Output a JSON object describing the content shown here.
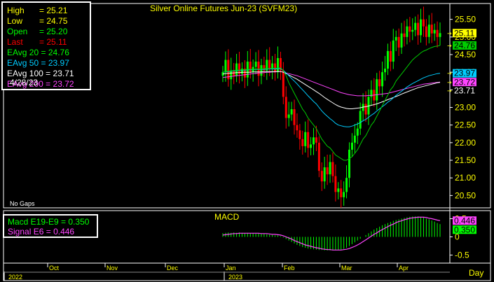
{
  "title": "Silver Online Futures Jun-23 (SVFM23)",
  "info": {
    "high_label": "High",
    "high": "25.21",
    "low_label": "Low",
    "low": "24.75",
    "open_label": "Open",
    "open": "25.20",
    "last_label": "Last",
    "last": "25.11",
    "eavg20_label": "EAvg 20",
    "eavg20": "24.76",
    "eavg50_label": "EAvg 50",
    "eavg50": "23.97",
    "eavg100_label": "EAvg 100",
    "eavg100": "23.71",
    "eavg200_label": "EAvg 200",
    "eavg200": "23.72",
    "date": "4/28/23"
  },
  "no_gaps": "No Gaps",
  "macd": {
    "title": "MACD",
    "macd_label": "Macd E19-E9 =",
    "macd_value": "0.350",
    "signal_label": "Signal E6 =",
    "signal_value": "0.446",
    "tag_signal": "0.446",
    "tag_macd": "0.350"
  },
  "price_tags": {
    "last": "25.11",
    "eavg20": "24.76",
    "eavg50": "23.97",
    "eavg200": "23.72",
    "eavg100": "23.71"
  },
  "x_axis": {
    "months": [
      "Oct",
      "Nov",
      "Dec",
      "Jan",
      "Feb",
      "Mar",
      "Apr"
    ],
    "years": [
      "2022",
      "2023"
    ],
    "period_label": "Day"
  },
  "colors": {
    "up": "#00ff00",
    "down": "#ff0000",
    "neutral": "#ffff00",
    "eavg20": "#00cc00",
    "eavg50": "#00ccff",
    "eavg100": "#ffffff",
    "eavg200": "#ff44ff",
    "macd_hist": "#00ff00",
    "signal": "#ff44ff",
    "axis_text": "#ffff00"
  },
  "chart_data": [
    {
      "type": "candlestick",
      "title": "Silver Online Futures Jun-23 (SVFM23)",
      "y_ticks": [
        20.5,
        21.0,
        21.5,
        22.0,
        22.5,
        23.0,
        23.5,
        24.0,
        24.5,
        25.0,
        25.5
      ],
      "ylim": [
        20.15,
        25.95
      ],
      "bar_count": 80,
      "month_start_index": {
        "Jan": 0,
        "Feb": 22,
        "Mar": 42,
        "Apr": 64
      },
      "closes": [
        24.0,
        24.35,
        23.8,
        24.05,
        23.9,
        24.25,
        23.95,
        24.1,
        23.85,
        24.3,
        24.0,
        24.15,
        24.3,
        23.9,
        24.2,
        24.05,
        24.35,
        24.1,
        24.25,
        24.0,
        24.4,
        24.05,
        23.3,
        22.7,
        22.8,
        22.95,
        22.5,
        22.35,
        22.1,
        21.9,
        22.3,
        21.85,
        21.95,
        22.15,
        22.0,
        21.2,
        20.9,
        21.3,
        21.1,
        21.45,
        21.05,
        20.6,
        20.7,
        20.45,
        20.6,
        21.0,
        21.8,
        22.0,
        22.2,
        22.4,
        22.9,
        23.1,
        22.8,
        23.3,
        23.5,
        23.2,
        23.8,
        23.6,
        24.0,
        24.1,
        24.6,
        24.3,
        24.9,
        25.0,
        24.7,
        25.1,
        25.0,
        25.3,
        25.15,
        25.2,
        25.4,
        25.05,
        25.5,
        25.3,
        25.0,
        25.35,
        25.1,
        25.2,
        25.0,
        25.11
      ],
      "eavg20": [
        24.0,
        24.02,
        24.03,
        24.04,
        24.05,
        24.06,
        24.06,
        24.07,
        24.07,
        24.08,
        24.08,
        24.08,
        24.09,
        24.09,
        24.09,
        24.1,
        24.1,
        24.1,
        24.11,
        24.11,
        24.12,
        24.12,
        24.05,
        23.9,
        23.7,
        23.55,
        23.4,
        23.25,
        23.1,
        22.95,
        22.85,
        22.7,
        22.6,
        22.5,
        22.4,
        22.25,
        22.1,
        22.0,
        21.9,
        21.85,
        21.75,
        21.65,
        21.6,
        21.55,
        21.5,
        21.5,
        21.55,
        21.6,
        21.7,
        21.8,
        21.95,
        22.1,
        22.2,
        22.35,
        22.5,
        22.6,
        22.75,
        22.9,
        23.05,
        23.2,
        23.35,
        23.5,
        23.6,
        23.75,
        23.85,
        23.95,
        24.05,
        24.15,
        24.25,
        24.35,
        24.42,
        24.48,
        24.55,
        24.6,
        24.63,
        24.67,
        24.7,
        24.73,
        24.74,
        24.76
      ],
      "eavg50": [
        24.0,
        24.01,
        24.02,
        24.03,
        24.04,
        24.05,
        24.05,
        24.06,
        24.06,
        24.07,
        24.07,
        24.07,
        24.08,
        24.08,
        24.08,
        24.08,
        24.09,
        24.09,
        24.09,
        24.09,
        24.1,
        24.1,
        24.05,
        23.98,
        23.9,
        23.82,
        23.75,
        23.67,
        23.58,
        23.5,
        23.42,
        23.33,
        23.25,
        23.17,
        23.1,
        23.0,
        22.9,
        22.82,
        22.75,
        22.68,
        22.62,
        22.55,
        22.5,
        22.48,
        22.46,
        22.45,
        22.45,
        22.47,
        22.5,
        22.53,
        22.57,
        22.62,
        22.66,
        22.72,
        22.78,
        22.83,
        22.9,
        22.96,
        23.02,
        23.08,
        23.15,
        23.2,
        23.27,
        23.34,
        23.4,
        23.46,
        23.52,
        23.58,
        23.63,
        23.68,
        23.72,
        23.76,
        23.8,
        23.84,
        23.87,
        23.9,
        23.92,
        23.94,
        23.96,
        23.97
      ],
      "eavg100": [
        23.95,
        23.96,
        23.97,
        23.98,
        23.98,
        23.99,
        23.99,
        24.0,
        24.0,
        24.0,
        24.0,
        24.01,
        24.01,
        24.01,
        24.01,
        24.02,
        24.02,
        24.02,
        24.02,
        24.02,
        24.02,
        24.02,
        24.0,
        23.96,
        23.92,
        23.88,
        23.84,
        23.8,
        23.75,
        23.7,
        23.65,
        23.6,
        23.55,
        23.5,
        23.45,
        23.4,
        23.34,
        23.28,
        23.23,
        23.18,
        23.13,
        23.08,
        23.04,
        23.01,
        22.99,
        22.97,
        22.96,
        22.96,
        22.97,
        22.98,
        22.99,
        23.01,
        23.02,
        23.04,
        23.06,
        23.08,
        23.1,
        23.13,
        23.16,
        23.19,
        23.22,
        23.25,
        23.28,
        23.31,
        23.34,
        23.38,
        23.41,
        23.44,
        23.47,
        23.5,
        23.53,
        23.56,
        23.58,
        23.6,
        23.62,
        23.64,
        23.66,
        23.68,
        23.7,
        23.71
      ],
      "eavg200": [
        23.85,
        23.86,
        23.87,
        23.88,
        23.89,
        23.9,
        23.91,
        23.92,
        23.93,
        23.94,
        23.95,
        23.96,
        23.97,
        23.98,
        23.98,
        23.99,
        24.0,
        24.0,
        24.01,
        24.01,
        24.02,
        24.02,
        24.0,
        23.98,
        23.96,
        23.94,
        23.92,
        23.9,
        23.87,
        23.84,
        23.81,
        23.78,
        23.75,
        23.72,
        23.69,
        23.66,
        23.63,
        23.6,
        23.57,
        23.54,
        23.51,
        23.48,
        23.45,
        23.42,
        23.4,
        23.38,
        23.36,
        23.35,
        23.34,
        23.33,
        23.33,
        23.33,
        23.33,
        23.34,
        23.34,
        23.35,
        23.36,
        23.37,
        23.38,
        23.39,
        23.4,
        23.42,
        23.44,
        23.46,
        23.48,
        23.5,
        23.52,
        23.54,
        23.56,
        23.58,
        23.6,
        23.62,
        23.64,
        23.66,
        23.67,
        23.68,
        23.69,
        23.7,
        23.71,
        23.72
      ]
    },
    {
      "type": "bar",
      "title": "MACD",
      "y_ticks": [
        0.5,
        0,
        -0.5
      ],
      "ylim": [
        -0.72,
        0.72
      ],
      "macd": [
        0.1,
        0.11,
        0.12,
        0.11,
        0.12,
        0.11,
        0.12,
        0.11,
        0.1,
        0.11,
        0.1,
        0.1,
        0.09,
        0.09,
        0.08,
        0.08,
        0.07,
        0.06,
        0.05,
        0.04,
        0.04,
        0.02,
        -0.02,
        -0.06,
        -0.1,
        -0.14,
        -0.18,
        -0.22,
        -0.25,
        -0.28,
        -0.3,
        -0.32,
        -0.33,
        -0.34,
        -0.35,
        -0.36,
        -0.36,
        -0.37,
        -0.37,
        -0.37,
        -0.37,
        -0.37,
        -0.36,
        -0.35,
        -0.33,
        -0.3,
        -0.25,
        -0.2,
        -0.15,
        -0.1,
        -0.05,
        0.0,
        0.05,
        0.1,
        0.15,
        0.2,
        0.24,
        0.28,
        0.32,
        0.35,
        0.38,
        0.41,
        0.44,
        0.46,
        0.48,
        0.5,
        0.52,
        0.54,
        0.55,
        0.56,
        0.56,
        0.56,
        0.55,
        0.53,
        0.5,
        0.48,
        0.45,
        0.42,
        0.38,
        0.35
      ],
      "signal": [
        0.05,
        0.06,
        0.07,
        0.08,
        0.09,
        0.09,
        0.1,
        0.1,
        0.1,
        0.1,
        0.1,
        0.1,
        0.1,
        0.1,
        0.09,
        0.09,
        0.09,
        0.08,
        0.07,
        0.07,
        0.06,
        0.05,
        0.03,
        0.0,
        -0.03,
        -0.06,
        -0.1,
        -0.13,
        -0.16,
        -0.19,
        -0.22,
        -0.24,
        -0.26,
        -0.28,
        -0.3,
        -0.31,
        -0.33,
        -0.34,
        -0.35,
        -0.35,
        -0.36,
        -0.36,
        -0.36,
        -0.36,
        -0.35,
        -0.34,
        -0.32,
        -0.29,
        -0.26,
        -0.22,
        -0.18,
        -0.13,
        -0.08,
        -0.03,
        0.02,
        0.07,
        0.11,
        0.16,
        0.2,
        0.24,
        0.28,
        0.32,
        0.35,
        0.39,
        0.42,
        0.44,
        0.47,
        0.49,
        0.51,
        0.52,
        0.53,
        0.54,
        0.54,
        0.54,
        0.53,
        0.51,
        0.5,
        0.48,
        0.46,
        0.446
      ]
    }
  ]
}
